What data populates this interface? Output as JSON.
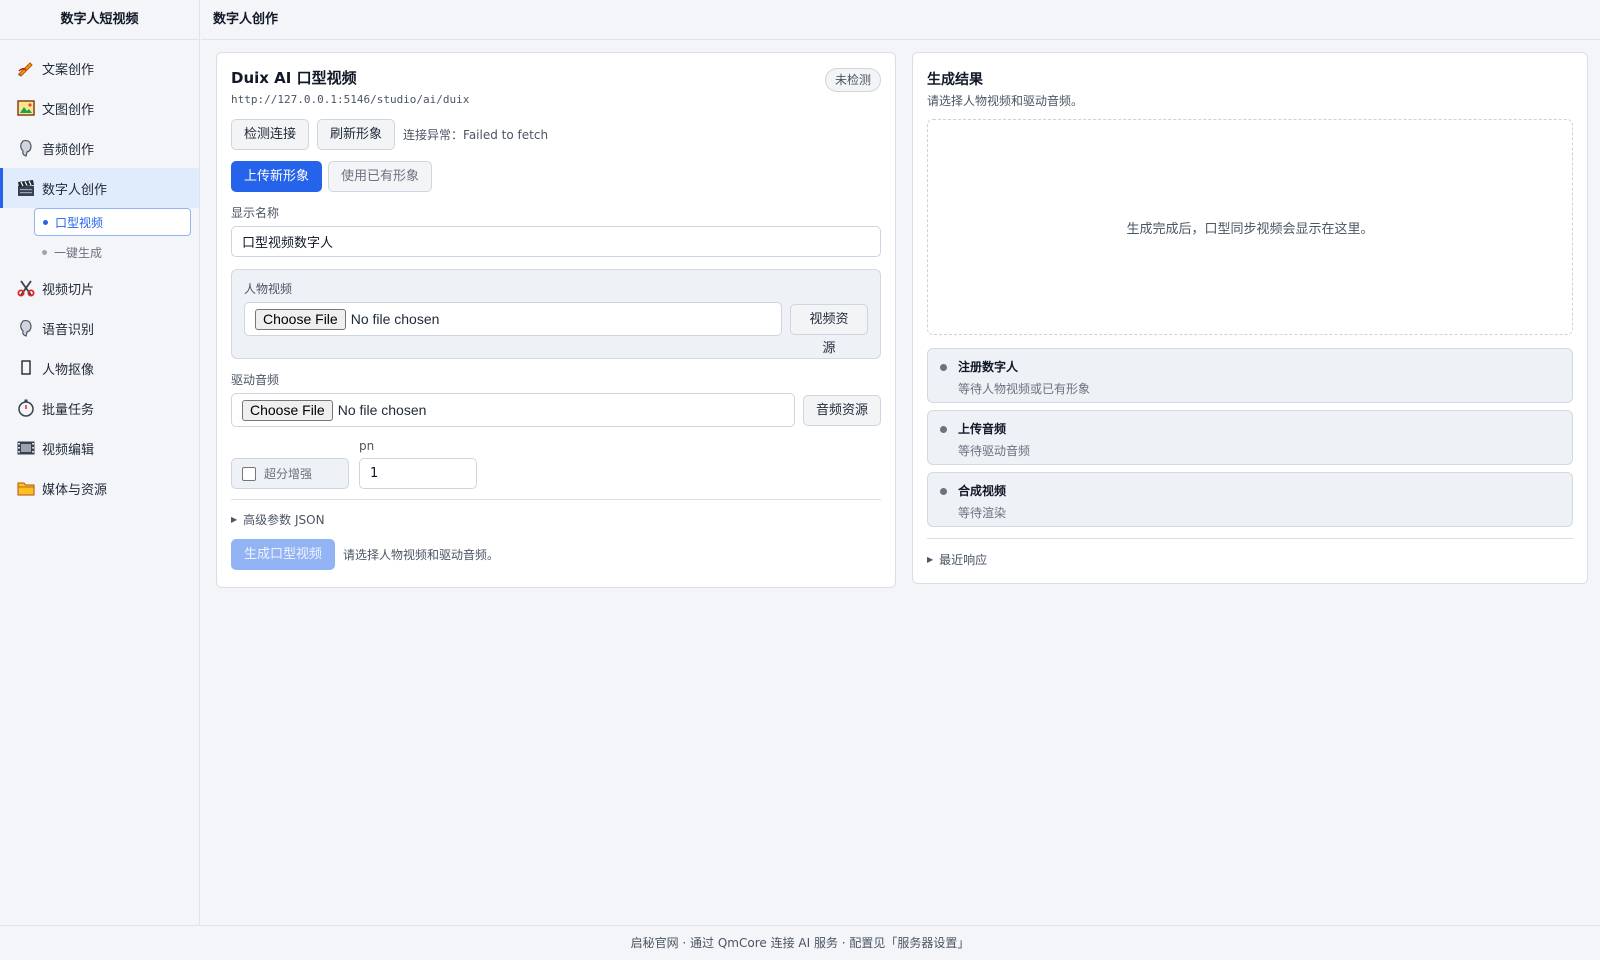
{
  "app": {
    "brand": "数字人短视频",
    "page_title": "数字人创作"
  },
  "sidebar": {
    "items": [
      {
        "label": "文案创作",
        "icon": "pen-icon"
      },
      {
        "label": "文图创作",
        "icon": "picture-icon"
      },
      {
        "label": "音频创作",
        "icon": "audio-icon"
      },
      {
        "label": "数字人创作",
        "icon": "clapper-icon"
      },
      {
        "label": "视频切片",
        "icon": "scissors-icon"
      },
      {
        "label": "语音识别",
        "icon": "speech-icon"
      },
      {
        "label": "人物抠像",
        "icon": "person-cutout-icon"
      },
      {
        "label": "批量任务",
        "icon": "stopwatch-icon"
      },
      {
        "label": "视频编辑",
        "icon": "film-icon"
      },
      {
        "label": "媒体与资源",
        "icon": "folder-icon"
      }
    ],
    "sub_items": [
      {
        "label": "口型视频"
      },
      {
        "label": "一键生成"
      }
    ]
  },
  "form": {
    "title": "Duix AI 口型视频",
    "url": "http://127.0.0.1:5146/studio/ai/duix",
    "badge": "未检测",
    "check_button": "检测连接",
    "refresh_button": "刷新形象",
    "connection_status": "连接异常：Failed to fetch",
    "mode_upload": "上传新形象",
    "mode_existing": "使用已有形象",
    "name_label": "显示名称",
    "name_value": "口型视频数字人",
    "video_label": "人物视频",
    "video_choose": "Choose File",
    "video_file": "No file chosen",
    "video_resource_button": "视频资源",
    "audio_label": "驱动音频",
    "audio_choose": "Choose File",
    "audio_file": "No file chosen",
    "audio_resource_button": "音频资源",
    "enhance_label": "超分增强",
    "enhance_checked": false,
    "pn_label": "pn",
    "pn_value": "1",
    "advanced_label": "高级参数 JSON",
    "generate_button": "生成口型视频",
    "generate_hint": "请选择人物视频和驱动音频。"
  },
  "result": {
    "title": "生成结果",
    "subtitle": "请选择人物视频和驱动音频。",
    "preview_text": "生成完成后，口型同步视频会显示在这里。",
    "steps": [
      {
        "title": "注册数字人",
        "desc": "等待人物视频或已有形象"
      },
      {
        "title": "上传音频",
        "desc": "等待驱动音频"
      },
      {
        "title": "合成视频",
        "desc": "等待渲染"
      }
    ],
    "recent_label": "最近响应"
  },
  "footer": {
    "text": "启秘官网 · 通过 QmCore 连接 AI 服务 · 配置见「服务器设置」"
  }
}
